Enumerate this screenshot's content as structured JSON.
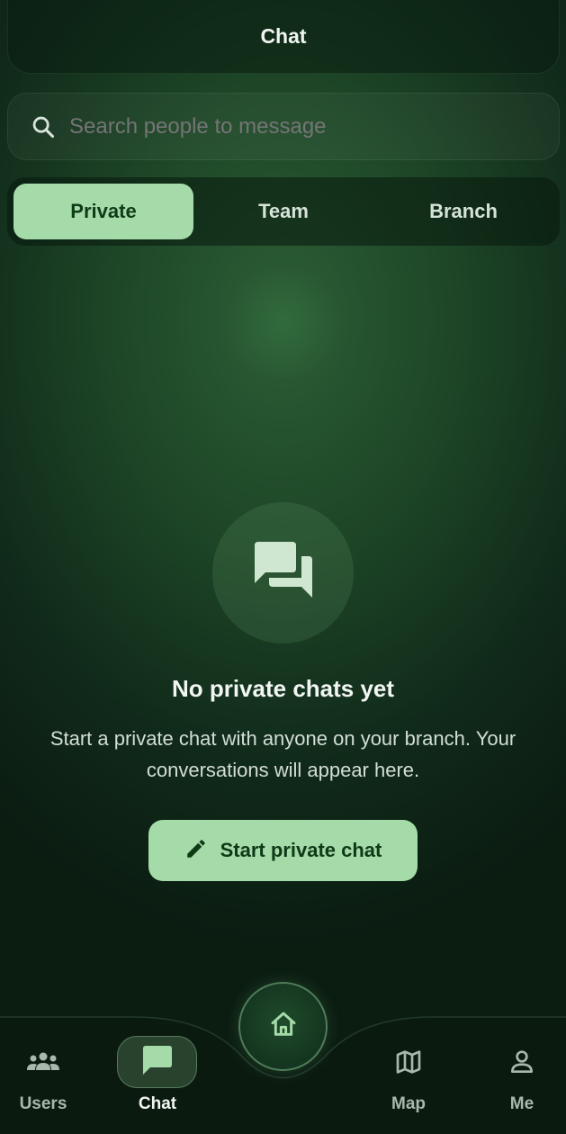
{
  "header": {
    "title": "Chat"
  },
  "search": {
    "placeholder": "Search people to message",
    "icon": "search-icon"
  },
  "tabs": [
    {
      "label": "Private",
      "active": true
    },
    {
      "label": "Team",
      "active": false
    },
    {
      "label": "Branch",
      "active": false
    }
  ],
  "empty_state": {
    "icon": "chat-bubbles-icon",
    "title": "No private chats yet",
    "description": "Start a private chat with anyone on your branch. Your conversations will appear here.",
    "button_label": "Start private chat",
    "button_icon": "pencil-icon"
  },
  "bottom_nav": {
    "items": [
      {
        "label": "Users",
        "icon": "users-icon",
        "active": false
      },
      {
        "label": "Chat",
        "icon": "chat-icon",
        "active": true
      },
      {
        "label": "Map",
        "icon": "map-icon",
        "active": false
      },
      {
        "label": "Me",
        "icon": "person-icon",
        "active": false
      }
    ],
    "center_button_icon": "home-icon"
  },
  "colors": {
    "accent": "#a5dba9",
    "accent_text": "#0f3c17",
    "background": "#1d4526"
  }
}
